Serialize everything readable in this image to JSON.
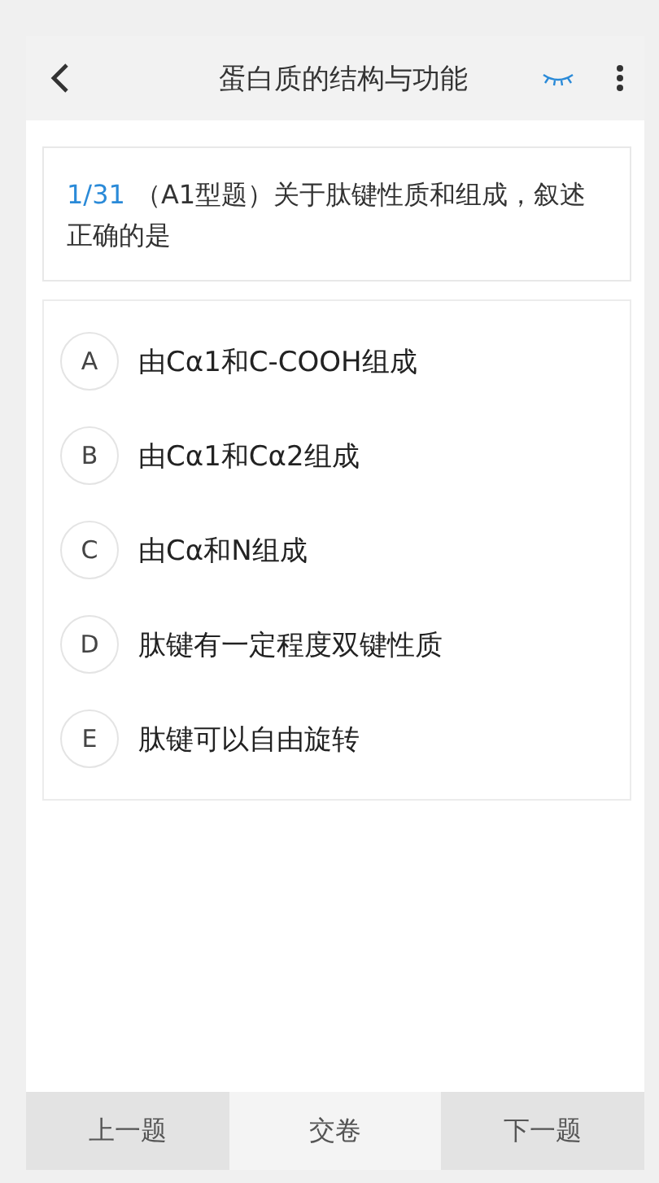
{
  "header": {
    "title": "蛋白质的结构与功能"
  },
  "question": {
    "number": "1/31",
    "text": "（A1型题）关于肽键性质和组成，叙述正确的是"
  },
  "options": [
    {
      "letter": "A",
      "text": "由Cα1和C-COOH组成"
    },
    {
      "letter": "B",
      "text": "由Cα1和Cα2组成"
    },
    {
      "letter": "C",
      "text": "由Cα和N组成"
    },
    {
      "letter": "D",
      "text": "肽键有一定程度双键性质"
    },
    {
      "letter": "E",
      "text": "肽键可以自由旋转"
    }
  ],
  "footer": [
    {
      "label": "上一题",
      "kind": "nav"
    },
    {
      "label": "交卷",
      "kind": "submit"
    },
    {
      "label": "下一题",
      "kind": "nav"
    }
  ]
}
